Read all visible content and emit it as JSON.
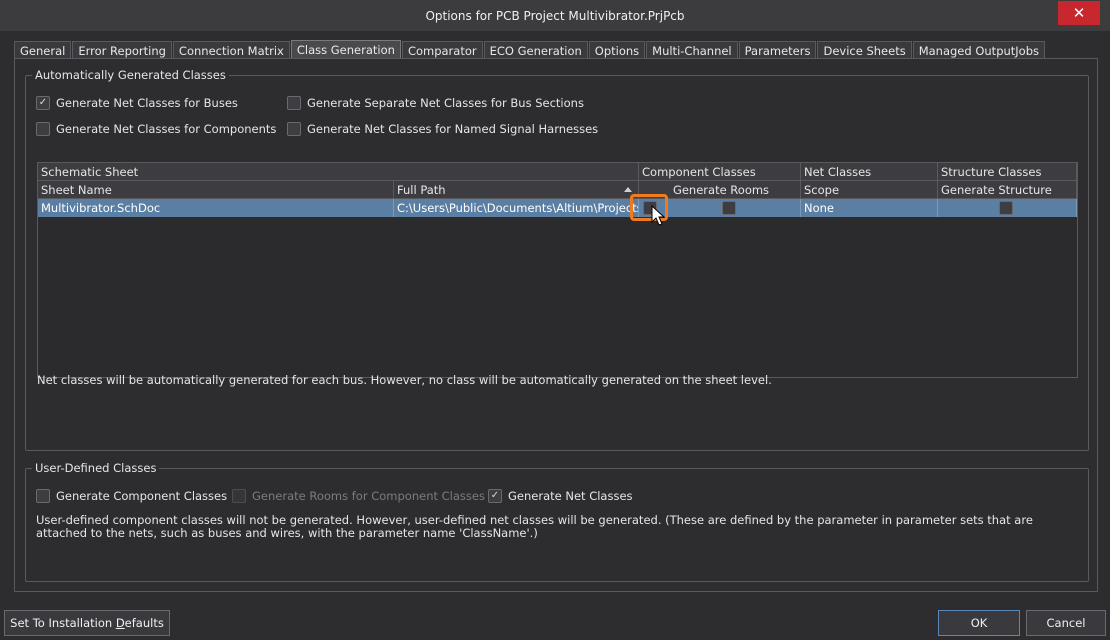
{
  "window": {
    "title": "Options for PCB Project Multivibrator.PrjPcb",
    "close_label": "✕"
  },
  "tabs": [
    {
      "label": "General"
    },
    {
      "label": "Error Reporting"
    },
    {
      "label": "Connection Matrix"
    },
    {
      "label": "Class Generation"
    },
    {
      "label": "Comparator"
    },
    {
      "label": "ECO Generation"
    },
    {
      "label": "Options"
    },
    {
      "label": "Multi-Channel"
    },
    {
      "label": "Parameters"
    },
    {
      "label": "Device Sheets"
    },
    {
      "label": "Managed OutputJobs"
    }
  ],
  "auto": {
    "title": "Automatically Generated Classes",
    "buses": {
      "label": "Generate Net Classes for Buses",
      "checked": true
    },
    "bus_sections": {
      "label": "Generate Separate Net Classes for Bus Sections",
      "checked": false
    },
    "components": {
      "label": "Generate Net Classes for Components",
      "checked": false
    },
    "harnesses": {
      "label": "Generate Net Classes for Named Signal Harnesses",
      "checked": false
    },
    "grid": {
      "group_headers": {
        "schematic": "Schematic Sheet",
        "component": "Component Classes",
        "net": "Net Classes",
        "structure": "Structure Classes"
      },
      "columns": {
        "sheet_name": "Sheet Name",
        "full_path": "Full Path",
        "generate_rooms": "Generate Rooms",
        "scope": "Scope",
        "generate_structure": "Generate Structure"
      },
      "rows": [
        {
          "sheet_name": "Multivibrator.SchDoc",
          "full_path": "C:\\Users\\Public\\Documents\\Altium\\Projects\\",
          "scope": "None"
        }
      ]
    },
    "note": "Net classes will be automatically generated for each bus. However, no class will be automatically generated on the sheet level."
  },
  "user": {
    "title": "User-Defined Classes",
    "component_classes": {
      "label": "Generate Component Classes",
      "checked": false
    },
    "rooms": {
      "label": "Generate Rooms for Component Classes",
      "checked": false
    },
    "net_classes": {
      "label": "Generate Net Classes",
      "checked": true
    },
    "note": "User-defined component classes will not be generated. However, user-defined net classes will be generated. (These are defined by the parameter in parameter sets that are attached to the nets, such as buses and wires, with the parameter name 'ClassName'.)"
  },
  "buttons": {
    "defaults_prefix": "Set To Installation ",
    "defaults_underline": "D",
    "defaults_suffix": "efaults",
    "ok": "OK",
    "cancel": "Cancel"
  },
  "colors": {
    "accent_highlight": "#f07a1e",
    "selected_row": "#5b7fa3",
    "close_button": "#c8282d"
  }
}
